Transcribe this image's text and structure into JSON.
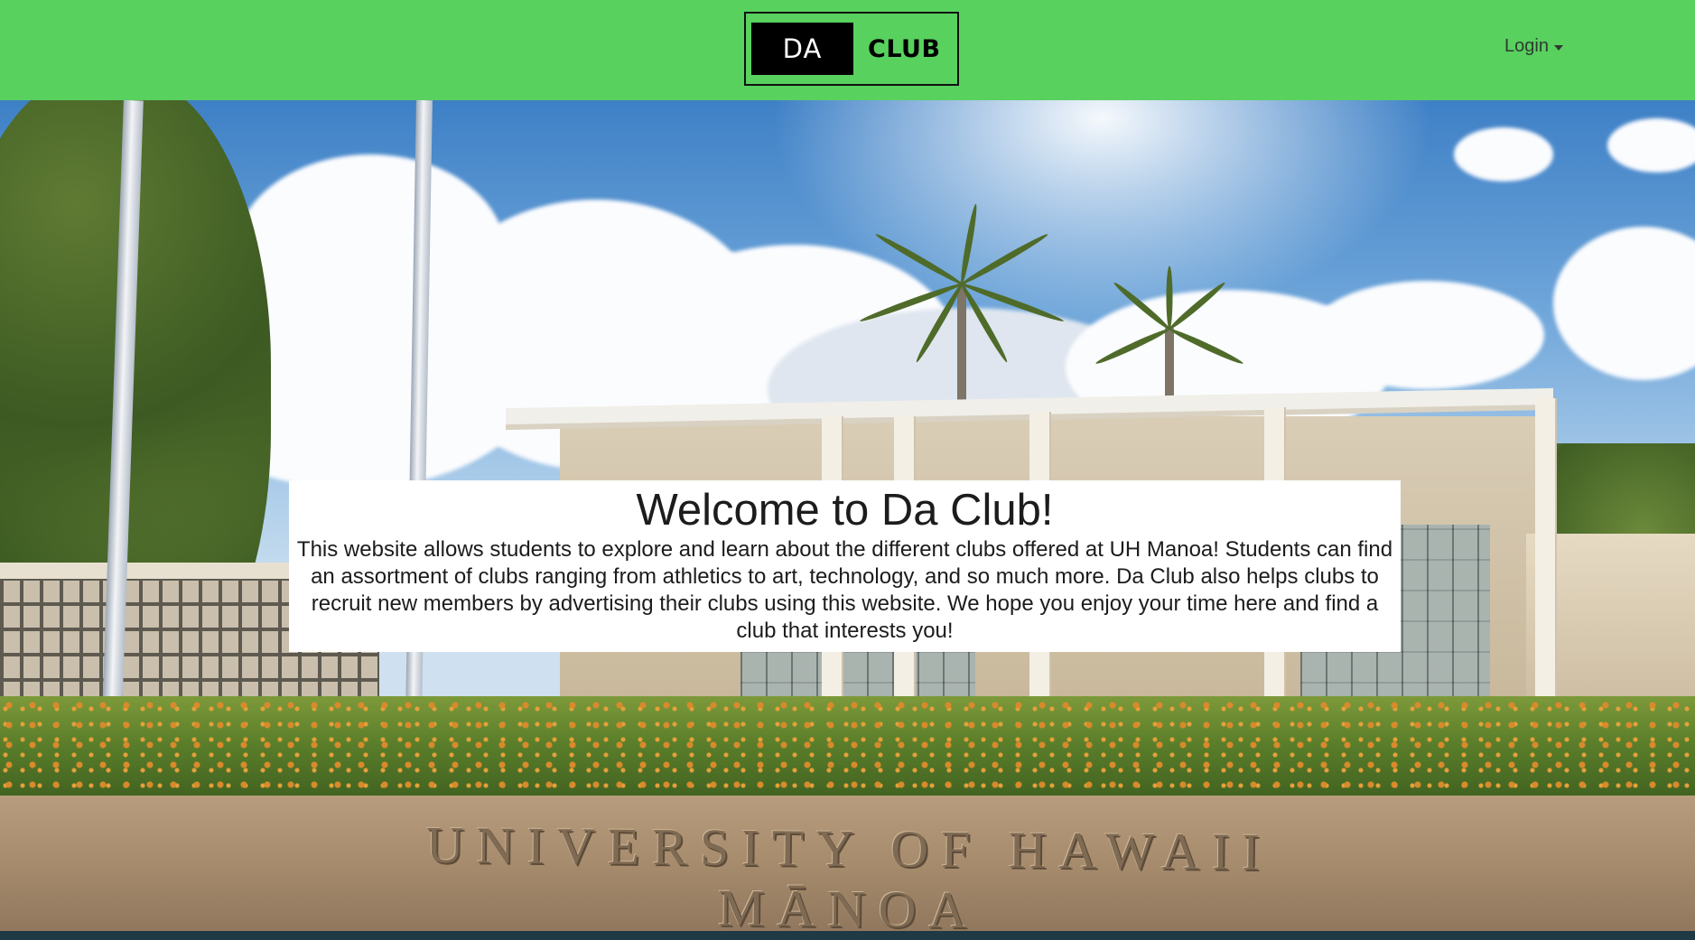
{
  "navbar": {
    "background": "#58d15f",
    "brand": {
      "part1": "DA",
      "part2": "CLUB"
    },
    "login_label": "Login"
  },
  "hero": {
    "sign_text": "UNIVERSITY OF HAWAII MĀNOA"
  },
  "welcome": {
    "title": "Welcome to Da Club!",
    "body": "This website allows students to explore and learn about the different clubs offered at UH Manoa! Students can find an assortment of clubs ranging from athletics to art, technology, and so much more. Da Club also helps clubs to recruit new members by advertising their clubs using this website. We hope you enjoy your time here and find a club that interests you!"
  },
  "icons": {
    "login_caret": "chevron-down-icon"
  }
}
